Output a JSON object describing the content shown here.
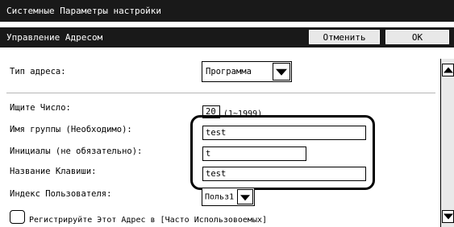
{
  "window": {
    "title": "Системные Параметры настройки"
  },
  "header": {
    "title": "Управление Адресом",
    "cancel_label": "Отменить",
    "ok_label": "OK"
  },
  "form": {
    "address_type": {
      "label": "Тип адреса:",
      "value": "Программа"
    },
    "search_number": {
      "label": "Ищите Число:",
      "value": "20",
      "hint": "(1~1999)"
    },
    "group_name": {
      "label": "Имя группы (Необходимо):",
      "value": "test"
    },
    "initials": {
      "label": "Инициалы (не обязательно):",
      "value": "t"
    },
    "key_name": {
      "label": "Название Клавиши:",
      "value": "test"
    },
    "user_index": {
      "label": "Индекс Пользователя:",
      "value": "Польз1"
    },
    "register_frequent": {
      "label": "Регистрируйте Этот Адрес в [Часто Использовоемых]",
      "checked": false
    }
  },
  "icons": {
    "dropdown_arrow": "triangle-down-icon",
    "scroll_up": "triangle-up-icon",
    "scroll_down": "triangle-down-icon"
  },
  "colors": {
    "title_bar": "#191919",
    "button_bg": "#e8e8e8",
    "scroll_track": "#e9e9e9"
  }
}
